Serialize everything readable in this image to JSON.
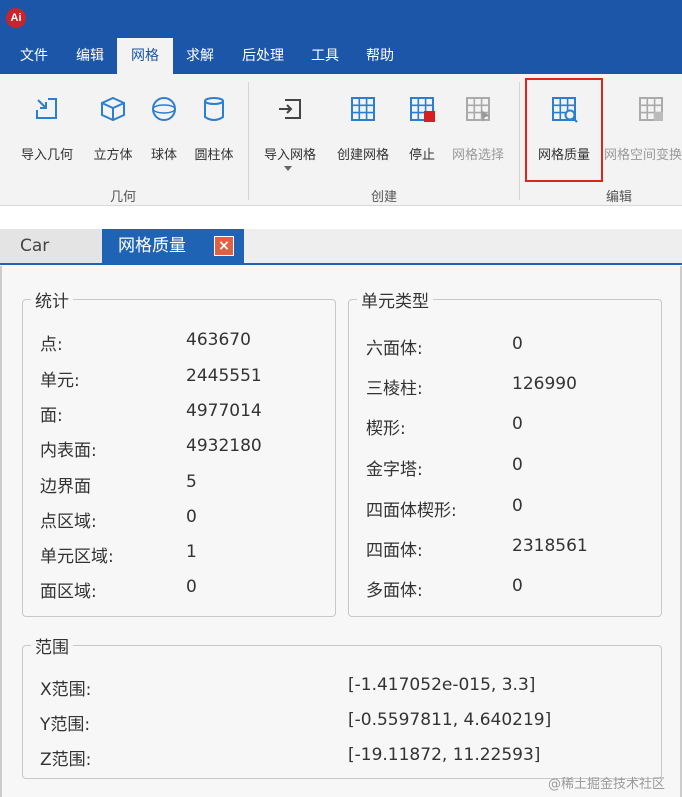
{
  "app": {
    "icon_letter": "Ai",
    "brand_color": "#1c56a8"
  },
  "menu": {
    "tabs": [
      {
        "label": "文件"
      },
      {
        "label": "编辑"
      },
      {
        "label": "网格",
        "active": true
      },
      {
        "label": "求解"
      },
      {
        "label": "后处理"
      },
      {
        "label": "工具"
      },
      {
        "label": "帮助"
      }
    ]
  },
  "ribbon": {
    "groups": {
      "geometry": "几何",
      "create": "创建",
      "edit": "编辑"
    },
    "buttons": {
      "import_geometry": "导入几何",
      "cube": "立方体",
      "sphere": "球体",
      "cylinder": "圆柱体",
      "import_mesh": "导入网格",
      "create_mesh": "创建网格",
      "stop": "停止",
      "mesh_select": "网格选择",
      "mesh_quality": "网格质量",
      "mesh_space_transform": "网格空间变换"
    }
  },
  "doc_tabs": {
    "car": "Car",
    "quality": "网格质量",
    "close_glyph": "×"
  },
  "statistics": {
    "title": "统计",
    "rows": [
      {
        "label": "点:",
        "value": "463670"
      },
      {
        "label": "单元:",
        "value": "2445551"
      },
      {
        "label": "面:",
        "value": "4977014"
      },
      {
        "label": "内表面:",
        "value": "4932180"
      },
      {
        "label": "边界面",
        "value": "5"
      },
      {
        "label": "点区域:",
        "value": "0"
      },
      {
        "label": "单元区域:",
        "value": "1"
      },
      {
        "label": "面区域:",
        "value": "0"
      }
    ]
  },
  "element_types": {
    "title": "单元类型",
    "rows": [
      {
        "label": "六面体:",
        "value": "0"
      },
      {
        "label": "三棱柱:",
        "value": "126990"
      },
      {
        "label": "楔形:",
        "value": "0"
      },
      {
        "label": "金字塔:",
        "value": "0"
      },
      {
        "label": "四面体楔形:",
        "value": "0"
      },
      {
        "label": "四面体:",
        "value": "2318561"
      },
      {
        "label": "多面体:",
        "value": "0"
      }
    ]
  },
  "range": {
    "title": "范围",
    "rows": [
      {
        "label": "X范围:",
        "value": "[-1.417052e-015, 3.3]"
      },
      {
        "label": "Y范围:",
        "value": "[-0.5597811, 4.640219]"
      },
      {
        "label": "Z范围:",
        "value": "[-19.11872, 11.22593]"
      }
    ]
  },
  "watermark": "@稀土掘金技术社区"
}
